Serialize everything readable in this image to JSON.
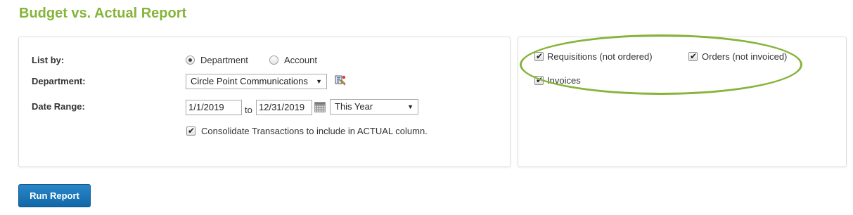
{
  "page": {
    "title": "Budget vs. Actual Report"
  },
  "form": {
    "list_by_label": "List by:",
    "list_by_options": [
      {
        "label": "Department",
        "selected": true
      },
      {
        "label": "Account",
        "selected": false
      }
    ],
    "department_label": "Department:",
    "department_value": "Circle Point Communications",
    "date_range_label": "Date Range:",
    "date_from": "1/1/2019",
    "date_to_label": "to",
    "date_to": "12/31/2019",
    "date_preset": "This Year",
    "consolidate_label": "Consolidate Transactions to include in ACTUAL column.",
    "consolidate_checked": true
  },
  "options": {
    "requisitions_label": "Requisitions (not ordered)",
    "requisitions_checked": true,
    "orders_label": "Orders (not invoiced)",
    "orders_checked": true,
    "invoices_label": "Invoices",
    "invoices_checked": true
  },
  "actions": {
    "run_report_label": "Run Report"
  },
  "colors": {
    "title": "#86b43a",
    "highlight_oval": "#86b43a",
    "button": "#1a74b8"
  },
  "icons": {
    "department_picker": "department-lookup-icon",
    "calendar": "calendar-icon"
  }
}
